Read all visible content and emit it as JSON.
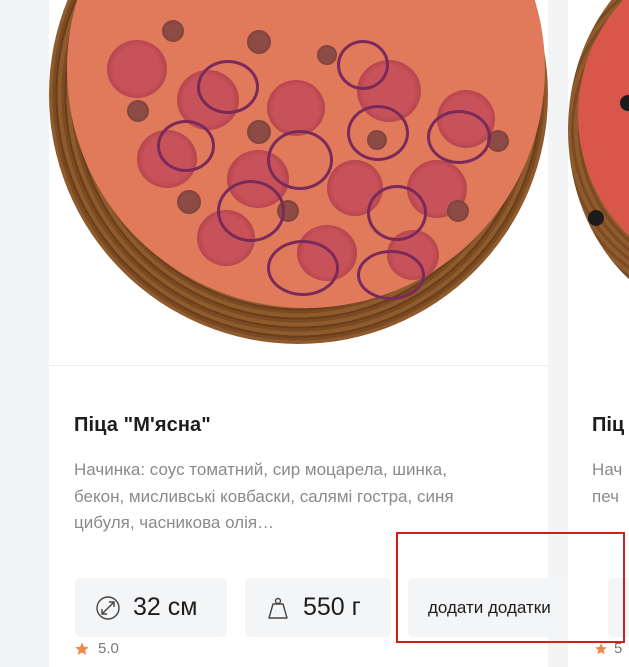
{
  "product": {
    "title": "Піца \"М'ясна\"",
    "description": "Начинка: соус томатний, сир моцарела, шинка, бекон, мисливські ковбаски, салямі гостра, синя цибуля, часникова олія…",
    "size": "32 см",
    "weight": "550 г",
    "addons_label": "додати додатки",
    "rating": "5.0"
  },
  "next_product": {
    "title_fragment": "Піц",
    "description_fragment_1": "Нач",
    "description_fragment_2": "печ",
    "rating_fragment": "5"
  },
  "colors": {
    "background": "#f3f4f6",
    "card": "#ffffff",
    "pill": "#f4f5f7",
    "star": "#f08a4b",
    "highlight": "#d41e1e"
  },
  "icons": {
    "size": "diameter-icon",
    "weight": "weight-icon",
    "rating": "star-icon"
  }
}
